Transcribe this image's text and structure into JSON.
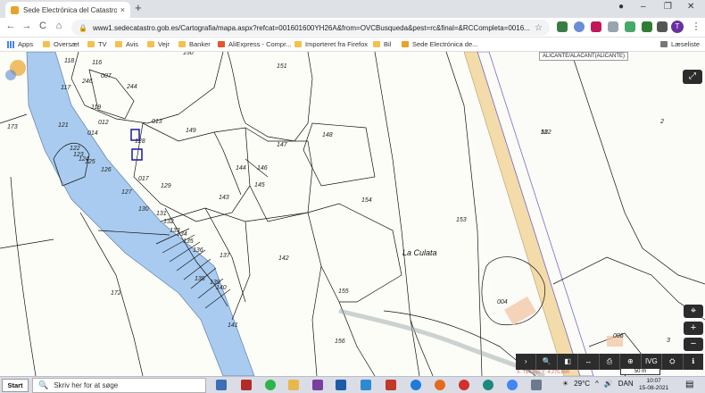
{
  "browser": {
    "tab_title": "Sede Electrónica del Catastro - P",
    "tab_close": "×",
    "new_tab": "+",
    "window_controls": {
      "minimize": "–",
      "restore": "❐",
      "close": "✕"
    },
    "tab_search": "●",
    "url": "www1.sedecatastro.gob.es/Cartografia/mapa.aspx?refcat=001601600YH26A&from=OVCBusqueda&pest=rc&final=&RCCompleta=0016...",
    "profile_initial": "T",
    "menu": "⋮",
    "nav": {
      "back": "←",
      "forward": "→",
      "reload": "C",
      "home": "⌂",
      "star": "☆",
      "lock": "🔒"
    }
  },
  "bookmarks": {
    "items": [
      "Apps",
      "Oversæt",
      "TV",
      "Avis",
      "Vejr",
      "Banker",
      "AliExpress - Compr...",
      "Importeret fra Firefox",
      "Bil",
      "Sede Electrónica de..."
    ],
    "reading_list": "Læseliste"
  },
  "map": {
    "region_label": "ALICANTE/ALACANT(ALICANTE)",
    "place_name": "La Culata",
    "parcels": [
      "118",
      "116",
      "007",
      "246",
      "117",
      "244",
      "119",
      "012",
      "013",
      "121",
      "014",
      "128",
      "122",
      "123",
      "124",
      "125",
      "126",
      "127",
      "017",
      "129",
      "130",
      "131",
      "132",
      "133",
      "134",
      "135",
      "136",
      "137",
      "138",
      "139",
      "140",
      "141",
      "142",
      "143",
      "144",
      "145",
      "146",
      "147",
      "148",
      "149",
      "150",
      "151",
      "152",
      "153",
      "154",
      "155",
      "156",
      "172",
      "173",
      "52",
      "2",
      "3",
      "004",
      "006"
    ],
    "scale_label": "50 m",
    "coords_text": "X: 714.350 Y: 4.275.090",
    "expand_icon": "⤢",
    "zoom": {
      "locate": "⌖",
      "in": "+",
      "out": "−"
    },
    "tools": [
      "›",
      "🔍",
      "◧",
      "↔",
      "⎙",
      "⊕",
      "IVG",
      "⛭",
      "ℹ"
    ]
  },
  "taskbar": {
    "start": "Start",
    "search_placeholder": "Skriv her for at søge",
    "weather": "29°C",
    "lang": "DAN",
    "time": "10:07",
    "date": "15-08-2021",
    "tray_up": "^",
    "tray_speaker": "🔊",
    "search_icon": "🔍",
    "weather_icon": "☀",
    "notif_icon": "▤"
  },
  "colors": {
    "river": "#a9cbef",
    "road": "#f0d49a",
    "boundary": "#111111",
    "accent_red": "#b33333"
  }
}
